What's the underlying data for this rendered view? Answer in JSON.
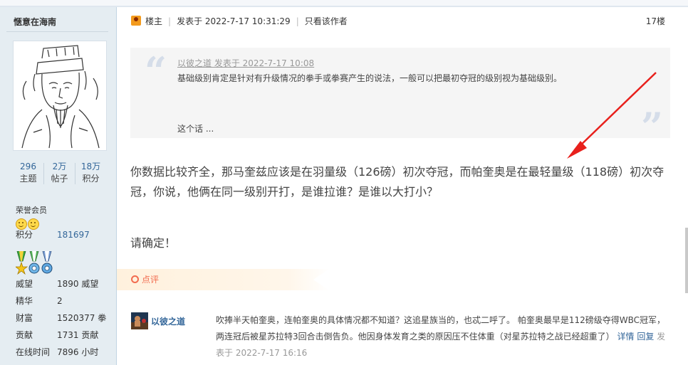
{
  "author": {
    "name": "惬意在海南",
    "stats": [
      {
        "value": "296",
        "label": "主题"
      },
      {
        "value": "2万",
        "label": "帖子"
      },
      {
        "value": "18万",
        "label": "积分"
      }
    ],
    "rank": "荣誉会员",
    "fields": [
      {
        "label": "积分",
        "value": "181697"
      },
      {
        "label": "威望",
        "value": "1890 威望"
      },
      {
        "label": "精华",
        "value": "2"
      },
      {
        "label": "财富",
        "value": "1520377 拳"
      },
      {
        "label": "贡献",
        "value": "1731 贡献"
      },
      {
        "label": "在线时间",
        "value": "7896 小时"
      }
    ]
  },
  "post": {
    "role": "楼主",
    "posted": "发表于 2022-7-17 10:31:29",
    "only_author": "只看该作者",
    "floor": "17楼",
    "quote": {
      "header": "以彼之道 发表于 2022-7-17 10:08",
      "body": "基础级别肯定是针对有升级情况的拳手或拳赛产生的说法，一般可以把最初夺冠的级别视为基础级别。",
      "more": "这个话 ..."
    },
    "message": "你数据比较齐全，那马奎兹应该是在羽量级（126磅）初次夺冠，而帕奎奥是在最轻量级（118磅）初次夺冠，你说，他俩在同一级别开打，是谁拉谁？是谁以大打小？",
    "message2": "请确定！"
  },
  "comments": {
    "label": "点评",
    "items": [
      {
        "user": "以彼之道",
        "text": "吹捧半天帕奎奥，连帕奎奥的具体情况都不知道？这追星族当的，也忒二呼了。 帕奎奥最早是112磅级夺得WBC冠军，两连冠后被星苏拉特3回合击倒告负。他因身体发育之类的原因压不住体重（对星苏拉特之战已经超重了）",
        "detail": "详情",
        "reply": "回复",
        "time": "发表于 2022-7-17 16:16"
      }
    ]
  },
  "colors": {
    "link": "#336699",
    "sidebar_bg": "#e5edf2",
    "accent_orange": "#f26c4f",
    "annotation_arrow": "#e8201c"
  }
}
